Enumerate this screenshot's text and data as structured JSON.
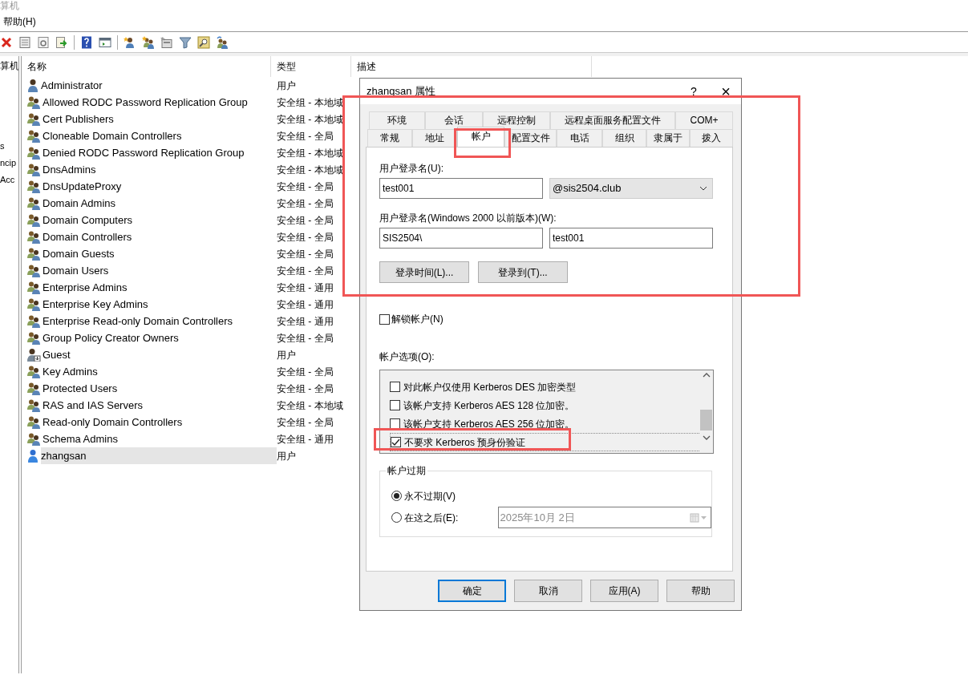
{
  "window": {
    "title": "算机"
  },
  "menu": [
    "帮助(H)"
  ],
  "left_pane": {
    "header": "算机",
    "items": [
      "s",
      "ncip",
      "Acc"
    ]
  },
  "list": {
    "columns": [
      "名称",
      "类型",
      "描述"
    ],
    "rows": [
      {
        "name": "Administrator",
        "type": "用户",
        "kind": "user",
        "selected": false
      },
      {
        "name": "Allowed RODC Password Replication Group",
        "type": "安全组 - 本地域",
        "kind": "group",
        "selected": false
      },
      {
        "name": "Cert Publishers",
        "type": "安全组 - 本地域",
        "kind": "group",
        "selected": false
      },
      {
        "name": "Cloneable Domain Controllers",
        "type": "安全组 - 全局",
        "kind": "group",
        "selected": false
      },
      {
        "name": "Denied RODC Password Replication Group",
        "type": "安全组 - 本地域",
        "kind": "group",
        "selected": false
      },
      {
        "name": "DnsAdmins",
        "type": "安全组 - 本地域",
        "kind": "group",
        "selected": false
      },
      {
        "name": "DnsUpdateProxy",
        "type": "安全组 - 全局",
        "kind": "group",
        "selected": false
      },
      {
        "name": "Domain Admins",
        "type": "安全组 - 全局",
        "kind": "group",
        "selected": false
      },
      {
        "name": "Domain Computers",
        "type": "安全组 - 全局",
        "kind": "group",
        "selected": false
      },
      {
        "name": "Domain Controllers",
        "type": "安全组 - 全局",
        "kind": "group",
        "selected": false
      },
      {
        "name": "Domain Guests",
        "type": "安全组 - 全局",
        "kind": "group",
        "selected": false
      },
      {
        "name": "Domain Users",
        "type": "安全组 - 全局",
        "kind": "group",
        "selected": false
      },
      {
        "name": "Enterprise Admins",
        "type": "安全组 - 通用",
        "kind": "group",
        "selected": false
      },
      {
        "name": "Enterprise Key Admins",
        "type": "安全组 - 通用",
        "kind": "group",
        "selected": false
      },
      {
        "name": "Enterprise Read-only Domain Controllers",
        "type": "安全组 - 通用",
        "kind": "group",
        "selected": false
      },
      {
        "name": "Group Policy Creator Owners",
        "type": "安全组 - 全局",
        "kind": "group",
        "selected": false
      },
      {
        "name": "Guest",
        "type": "用户",
        "kind": "guest",
        "selected": false
      },
      {
        "name": "Key Admins",
        "type": "安全组 - 全局",
        "kind": "group",
        "selected": false
      },
      {
        "name": "Protected Users",
        "type": "安全组 - 全局",
        "kind": "group",
        "selected": false
      },
      {
        "name": "RAS and IAS Servers",
        "type": "安全组 - 本地域",
        "kind": "group",
        "selected": false
      },
      {
        "name": "Read-only Domain Controllers",
        "type": "安全组 - 全局",
        "kind": "group",
        "selected": false
      },
      {
        "name": "Schema Admins",
        "type": "安全组 - 通用",
        "kind": "group",
        "selected": false
      },
      {
        "name": "zhangsan",
        "type": "用户",
        "kind": "user",
        "selected": true
      }
    ]
  },
  "dialog": {
    "title": "zhangsan 属性",
    "help": "?",
    "close": "×",
    "tab_rows": [
      [
        {
          "label": "环境",
          "selected": false
        },
        {
          "label": "会话",
          "selected": false
        },
        {
          "label": "远程控制",
          "selected": false
        },
        {
          "label": "远程桌面服务配置文件",
          "selected": false
        },
        {
          "label": "COM+",
          "selected": false
        }
      ],
      [
        {
          "label": "常规",
          "selected": false
        },
        {
          "label": "地址",
          "selected": false
        },
        {
          "label": "帐户",
          "selected": true
        },
        {
          "label": "配置文件",
          "selected": false
        },
        {
          "label": "电话",
          "selected": false
        },
        {
          "label": "组织",
          "selected": false
        },
        {
          "label": "隶属于",
          "selected": false
        },
        {
          "label": "拨入",
          "selected": false
        }
      ]
    ],
    "logon_name": {
      "label": "用户登录名(U):",
      "value": "test001",
      "domain": "@sis2504.club"
    },
    "pre2000": {
      "label": "用户登录名(Windows 2000 以前版本)(W):",
      "domain": "SIS2504\\",
      "value": "test001"
    },
    "action_buttons": [
      "登录时间(L)...",
      "登录到(T)..."
    ],
    "unlock": {
      "label": "解锁帐户(N)",
      "checked": false
    },
    "options": {
      "label": "帐户选项(O):",
      "items": [
        {
          "label": "对此帐户仅使用 Kerberos DES 加密类型",
          "checked": false
        },
        {
          "label": "该帐户支持 Kerberos AES 128 位加密。",
          "checked": false
        },
        {
          "label": "该帐户支持 Kerberos AES 256 位加密。",
          "checked": false
        },
        {
          "label": "不要求 Kerberos 预身份验证",
          "checked": true
        }
      ]
    },
    "expiry": {
      "title": "帐户过期",
      "choices": [
        {
          "label": "永不过期(V)",
          "selected": true
        },
        {
          "label": "在这之后(E):",
          "selected": false
        }
      ],
      "date": "2025年10月  2日",
      "date_disabled": true
    },
    "footer_buttons": [
      {
        "label": "确定",
        "default": true
      },
      {
        "label": "取消",
        "default": false
      },
      {
        "label": "应用(A)",
        "default": false
      },
      {
        "label": "帮助",
        "default": false
      }
    ]
  },
  "highlights": [
    {
      "kind": "section"
    },
    {
      "kind": "tab"
    },
    {
      "kind": "option"
    }
  ]
}
